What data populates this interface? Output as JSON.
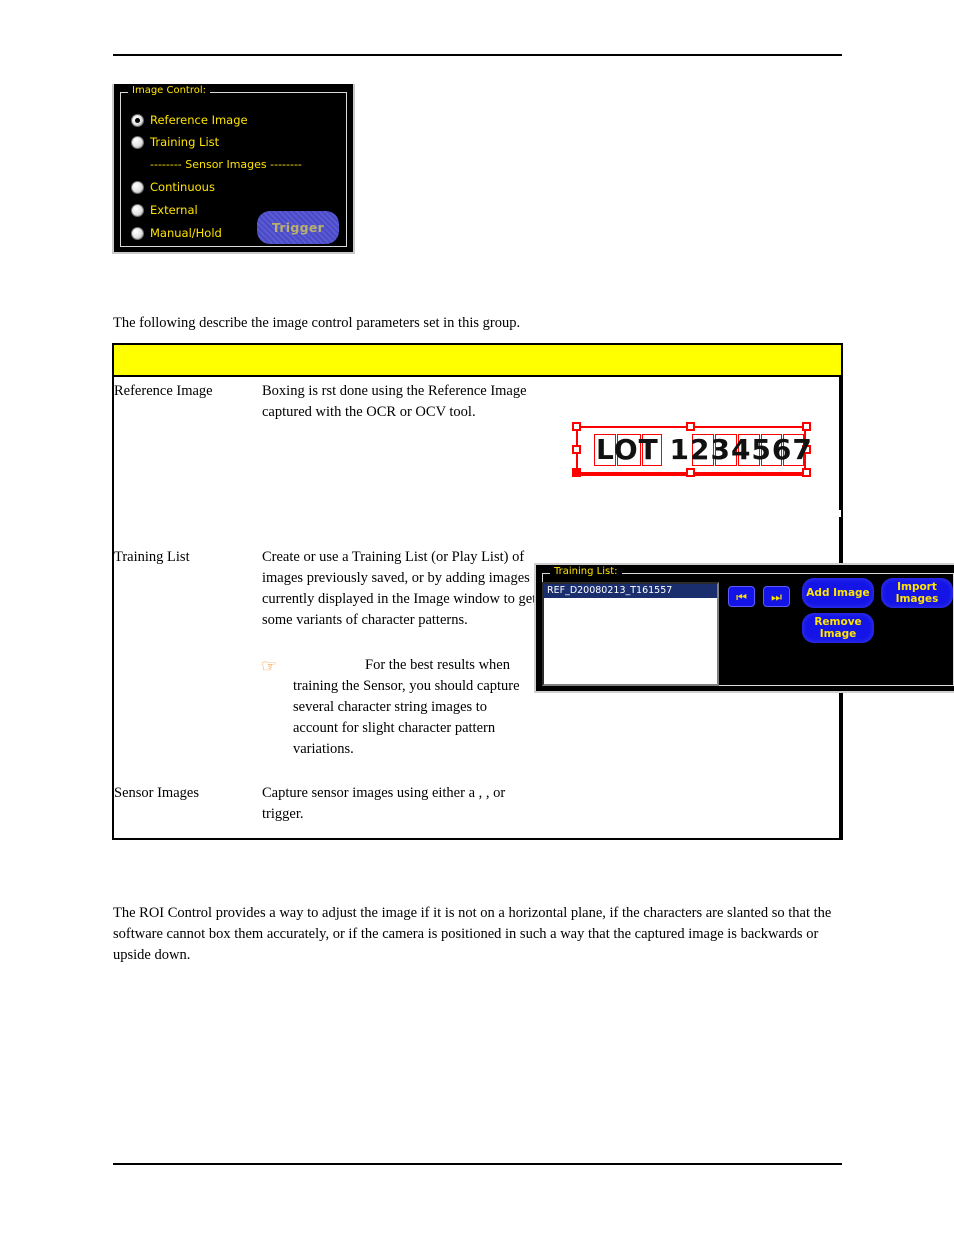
{
  "document": {
    "intro_paragraph": "The following describe the image control parameters set in this group.",
    "roi_paragraph": "The ROI Control provides a way to adjust the image if it is not on a horizontal plane, if the characters are slanted so that the software cannot box them accurately, or if the camera is positioned in such a way that the captured image is backwards or upside down."
  },
  "image_control_panel": {
    "title": "Image Control:",
    "options": [
      {
        "label": "Reference Image",
        "selected": true
      },
      {
        "label": "Training List",
        "selected": false
      }
    ],
    "divider_label": "-------- Sensor Images --------",
    "trigger_options": [
      {
        "label": "Continuous",
        "selected": false
      },
      {
        "label": "External",
        "selected": false
      },
      {
        "label": "Manual/Hold",
        "selected": false
      }
    ],
    "trigger_button_label": "Trigger",
    "colors": {
      "background": "#000000",
      "label_text": "#ffe400",
      "trigger_button": "#4a4ac4",
      "trigger_button_text": "#b9b06a"
    }
  },
  "parameter_table": {
    "header_label": "",
    "header_color": "#ffff00",
    "rows": [
      {
        "name": "Reference Image",
        "description": "Boxing is  rst done using the Reference Image captured with the OCR or OCV tool."
      },
      {
        "name": "Training List",
        "description": "Create or use a Training List (or Play List) of images previously saved, or by adding images currently displayed in the Image window to get some variants of character patterns."
      },
      {
        "name": "Sensor Images",
        "description": "Capture sensor images using either a            ,              , or trigger."
      }
    ]
  },
  "note": {
    "icon": "pointing-hand-icon",
    "text": "For the best results when training the Sensor, you should capture several character string images to account for slight character pattern variations."
  },
  "reference_image_graphic": {
    "text": "LOT 1234567",
    "roi_color": "#ff0000",
    "boxed_characters": [
      "L",
      "O",
      "T",
      "2",
      "3",
      "4",
      "5",
      "6",
      "7"
    ]
  },
  "training_list_panel": {
    "title": "Training List:",
    "list_items": [
      {
        "label": "REF_D20080213_T161557",
        "selected": true
      }
    ],
    "nav_buttons": [
      {
        "name": "first",
        "glyph": "⏮"
      },
      {
        "name": "last",
        "glyph": "⏭"
      }
    ],
    "action_buttons": [
      {
        "label": "Add Image"
      },
      {
        "label": "Import Images"
      },
      {
        "label": "Remove Image"
      }
    ],
    "colors": {
      "background": "#000000",
      "title_text": "#ffe400",
      "button": "#1414e6",
      "button_text": "#ffe400",
      "selection": "#1a2e6e"
    }
  }
}
